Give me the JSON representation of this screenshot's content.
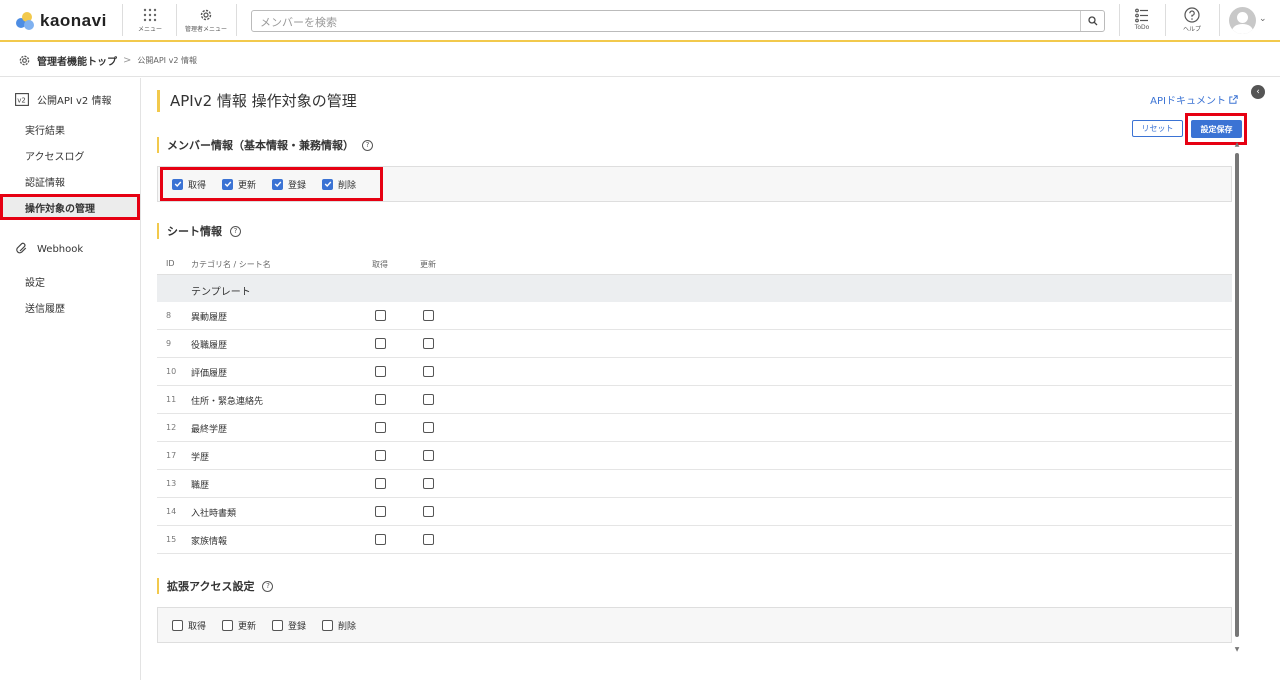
{
  "header": {
    "logo_text": "kaonavi",
    "menu_label": "メニュー",
    "admin_menu_label": "管理者メニュー",
    "search_placeholder": "メンバーを検索",
    "todo_label": "ToDo",
    "help_label": "ヘルプ"
  },
  "breadcrumb": {
    "home": "管理者機能トップ",
    "separator": ">",
    "current": "公開API v2 情報"
  },
  "sidebar": {
    "group1": "公開API v2 情報",
    "items1": [
      "実行結果",
      "アクセスログ",
      "認証情報",
      "操作対象の管理"
    ],
    "active_index": 3,
    "group2": "Webhook",
    "items2": [
      "設定",
      "送信履歴"
    ]
  },
  "main": {
    "title": "APIv2 情報 操作対象の管理",
    "api_doc_link": "APIドキュメント",
    "reset_label": "リセット",
    "save_label": "設定保存",
    "member_section": {
      "title": "メンバー情報（基本情報・兼務情報）",
      "options": [
        {
          "label": "取得",
          "checked": true
        },
        {
          "label": "更新",
          "checked": true
        },
        {
          "label": "登録",
          "checked": true
        },
        {
          "label": "削除",
          "checked": true
        }
      ]
    },
    "sheet_section": {
      "title": "シート情報",
      "columns": {
        "id": "ID",
        "name": "カテゴリ名 / シート名",
        "get": "取得",
        "update": "更新"
      },
      "template_label": "テンプレート",
      "rows": [
        {
          "id": "8",
          "name": "異動履歴"
        },
        {
          "id": "9",
          "name": "役職履歴"
        },
        {
          "id": "10",
          "name": "評価履歴"
        },
        {
          "id": "11",
          "name": "住所・緊急連絡先"
        },
        {
          "id": "12",
          "name": "最終学歴"
        },
        {
          "id": "17",
          "name": "学歴"
        },
        {
          "id": "13",
          "name": "職歴"
        },
        {
          "id": "14",
          "name": "入社時書類"
        },
        {
          "id": "15",
          "name": "家族情報"
        }
      ]
    },
    "ext_section": {
      "title": "拡張アクセス設定",
      "options": [
        {
          "label": "取得",
          "checked": false
        },
        {
          "label": "更新",
          "checked": false
        },
        {
          "label": "登録",
          "checked": false
        },
        {
          "label": "削除",
          "checked": false
        }
      ]
    }
  },
  "colors": {
    "accent_yellow": "#f2c94c",
    "primary_blue": "#3b73d4",
    "highlight_red": "#e60012"
  }
}
